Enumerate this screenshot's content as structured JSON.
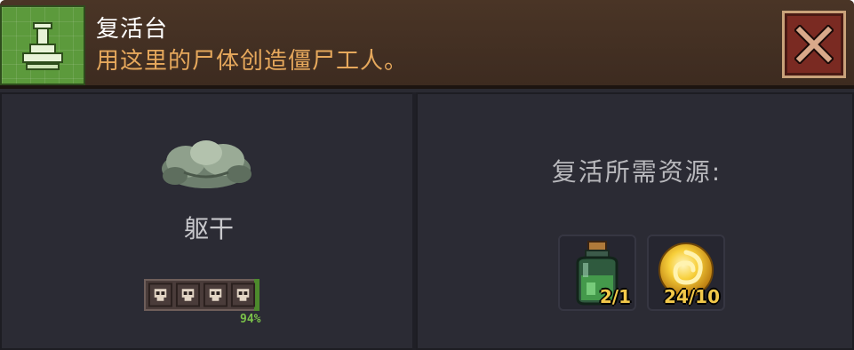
{
  "header": {
    "title": "复活台",
    "subtitle": "用这里的尸体创造僵尸工人。",
    "icon": "altar-icon",
    "close_icon": "close-icon"
  },
  "corpse": {
    "name": "躯干",
    "icon": "corpse-torso-icon",
    "quality_skulls": 4,
    "progress_percent": "94%",
    "progress_value": 0.94
  },
  "requirements": {
    "title": "复活所需资源:",
    "items": [
      {
        "icon": "green-potion-bottle-icon",
        "count": "2/1"
      },
      {
        "icon": "gold-orb-icon",
        "count": "24/10"
      }
    ]
  },
  "colors": {
    "header_bg": "#4a3526",
    "title": "#ffffff",
    "subtitle": "#e6a85c",
    "panel_bg": "#2b2b34",
    "progress_green": "#7bc24a",
    "count_yellow": "#f2c84a",
    "close_red": "#7a2a22"
  }
}
